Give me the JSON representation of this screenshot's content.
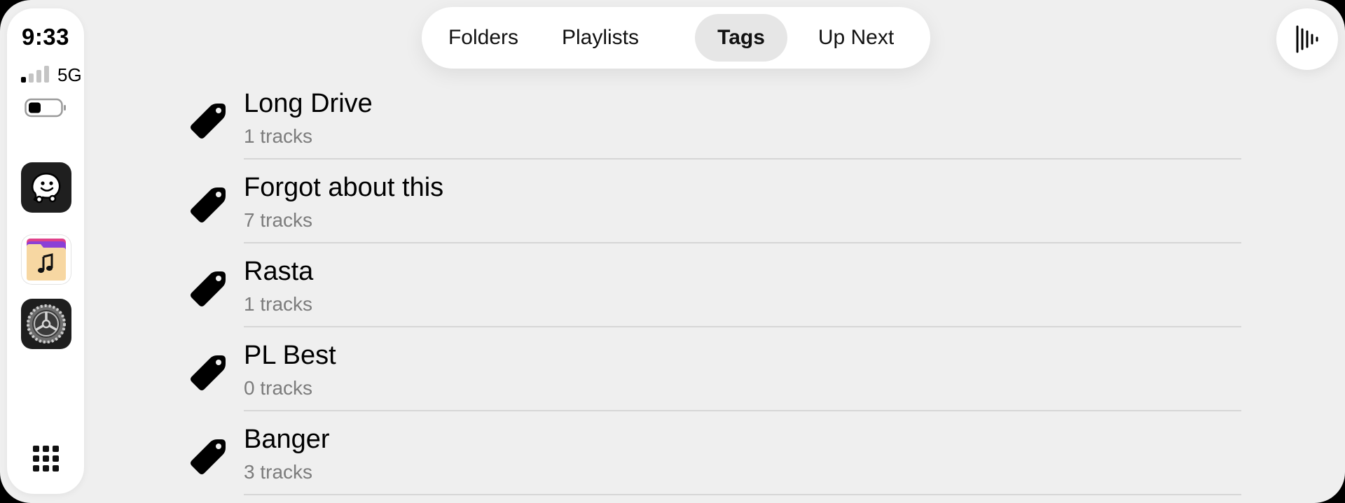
{
  "status": {
    "time": "9:33",
    "network": "5G",
    "signal_bars_active": 1,
    "signal_bars_total": 4
  },
  "dock": {
    "apps": [
      {
        "name": "waze-app-icon"
      },
      {
        "name": "music-files-app-icon"
      },
      {
        "name": "settings-app-icon"
      }
    ]
  },
  "tabs": {
    "items": [
      {
        "label": "Folders",
        "active": false
      },
      {
        "label": "Playlists",
        "active": false
      },
      {
        "label": "Tags",
        "active": true
      },
      {
        "label": "Up Next",
        "active": false
      }
    ]
  },
  "list": {
    "items": [
      {
        "title": "Long Drive",
        "subtitle": "1 tracks"
      },
      {
        "title": "Forgot about this",
        "subtitle": "7 tracks"
      },
      {
        "title": "Rasta",
        "subtitle": "1 tracks"
      },
      {
        "title": "PL Best",
        "subtitle": "0 tracks"
      },
      {
        "title": "Banger",
        "subtitle": "3 tracks"
      }
    ]
  },
  "colors": {
    "background": "#efefef",
    "panel": "#ffffff",
    "active_tab": "#e6e6e6",
    "subtitle": "#7c7c7c",
    "divider": "#d6d6d6"
  }
}
